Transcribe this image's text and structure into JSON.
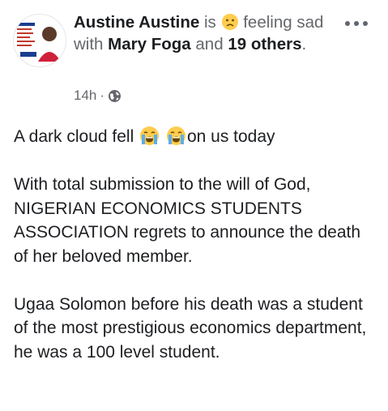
{
  "post": {
    "author": "Austine Austine",
    "is_text": "is",
    "feeling_text": "feeling sad with",
    "feeling_emoji": "sad-face-emoji",
    "tag1": "Mary Foga",
    "and_text": "and",
    "others": "19 others",
    "period": ".",
    "time": "14h",
    "separator": "·",
    "privacy_icon": "globe-icon",
    "line1_a": "A dark cloud fell",
    "line1_b": "on us today",
    "cry_emoji": "loudly-crying-face",
    "para2": "With total submission to the will of God, NIGERIAN ECONOMICS STUDENTS ASSOCIATION regrets to announce the death of her beloved member.",
    "para3": "Ugaa Solomon before his death was a student of the most prestigious economics department, he was a 100 level student."
  },
  "colors": {
    "text": "#1c1e21",
    "muted": "#65676b",
    "emoji": "#ffcc4d",
    "tear": "#5dadec"
  }
}
